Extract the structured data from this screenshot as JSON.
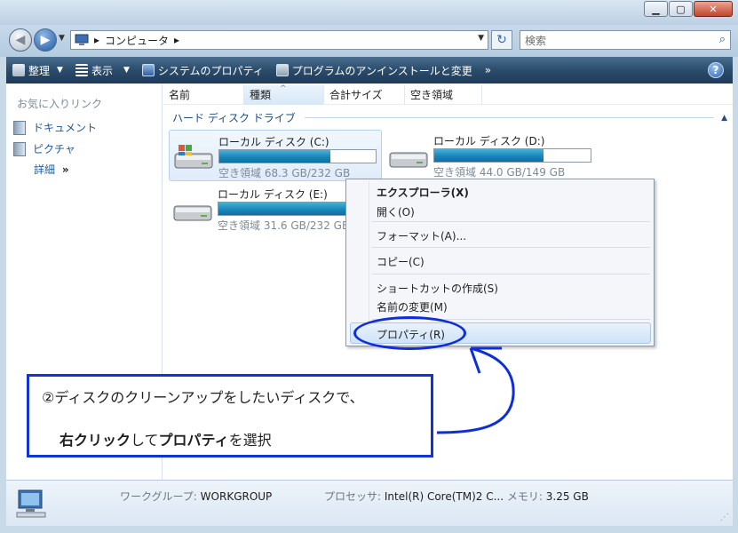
{
  "window": {
    "minimize": "▁",
    "maximize": "▢",
    "close": "✕"
  },
  "address": {
    "path_separator": "▸",
    "location": "コンピュータ",
    "trail_arrow": "▸"
  },
  "search": {
    "placeholder": "検索"
  },
  "toolbar": {
    "organize": "整理",
    "views": "表示",
    "system_properties": "システムのプロパティ",
    "uninstall": "プログラムのアンインストールと変更",
    "more": "»",
    "help": "?"
  },
  "nav": {
    "favorites_title": "お気に入りリンク",
    "items": [
      {
        "label": "ドキュメント"
      },
      {
        "label": "ピクチャ"
      }
    ],
    "details": "詳細",
    "details_chevron": "»"
  },
  "columns": [
    "名前",
    "種類",
    "合計サイズ",
    "空き領域"
  ],
  "group": {
    "title": "ハード ディスク ドライブ"
  },
  "drives": [
    {
      "name": "ローカル ディスク (C:)",
      "free": "空き領域 68.3 GB/232 GB",
      "used_fraction": 0.71,
      "selected": true
    },
    {
      "name": "ローカル ディスク (D:)",
      "free": "空き領域 44.0 GB/149 GB",
      "used_fraction": 0.7,
      "selected": false
    },
    {
      "name": "ローカル ディスク (E:)",
      "free": "空き領域 31.6 GB/232 GB",
      "used_fraction": 0.86,
      "selected": false
    }
  ],
  "context_menu": {
    "explorer": "エクスプローラ(X)",
    "open": "開く(O)",
    "format": "フォーマット(A)...",
    "copy": "コピー(C)",
    "shortcut": "ショートカットの作成(S)",
    "rename": "名前の変更(M)",
    "properties": "プロパティ(R)"
  },
  "annotation": {
    "line1": "②ディスクのクリーンアップをしたいディスクで、",
    "line2_a": "右クリック",
    "line2_b": "して",
    "line2_c": "プロパティ",
    "line2_d": "を選択"
  },
  "status": {
    "workgroup_label": "ワークグループ:",
    "workgroup_value": "WORKGROUP",
    "processor_label": "プロセッサ:",
    "processor_value": "Intel(R) Core(TM)2 C...",
    "memory_label": "メモリ:",
    "memory_value": "3.25 GB"
  },
  "colors": {
    "accent": "#1233d6",
    "toolbar": "#2b4c6b",
    "link": "#1f5b9a"
  }
}
